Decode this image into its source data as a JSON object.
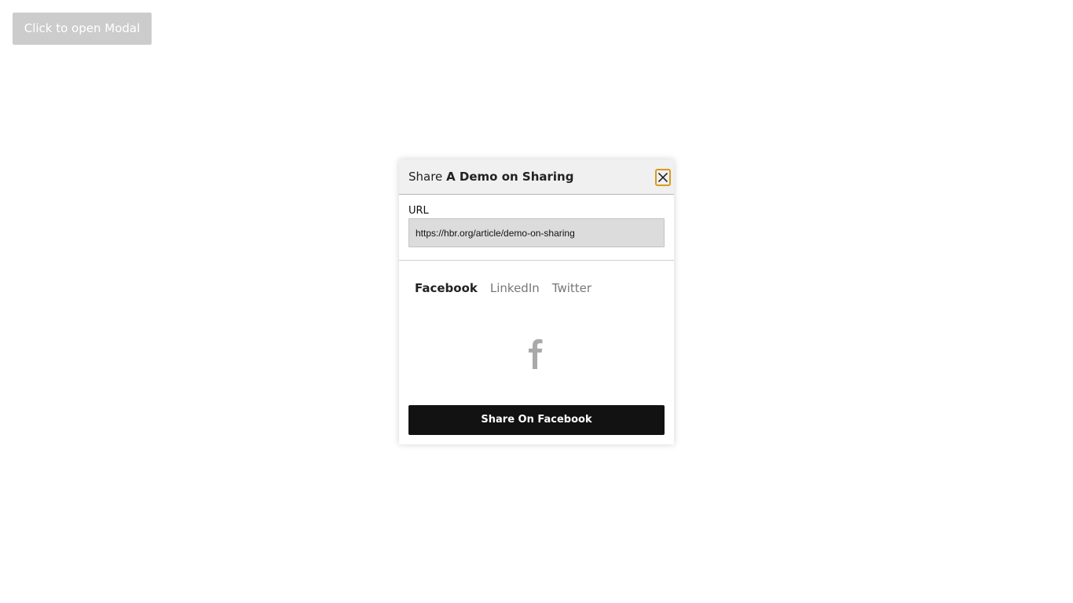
{
  "page": {
    "open_button_label": "Click to open Modal"
  },
  "modal": {
    "title_prefix": "Share",
    "title_article": "A Demo on Sharing",
    "close_icon": "close-icon",
    "url_label": "URL",
    "url_value": "https://hbr.org/article/demo-on-sharing",
    "tabs": [
      {
        "label": "Facebook",
        "active": true
      },
      {
        "label": "LinkedIn",
        "active": false
      },
      {
        "label": "Twitter",
        "active": false
      }
    ],
    "social_icon": "facebook-icon",
    "share_button_label": "Share On Facebook"
  },
  "colors": {
    "button_disabled": "#cccccc",
    "header_bg": "#eff0ef",
    "focus_ring": "#d99a1e",
    "share_button_bg": "#121212",
    "icon_gray": "#a9a9a9"
  }
}
